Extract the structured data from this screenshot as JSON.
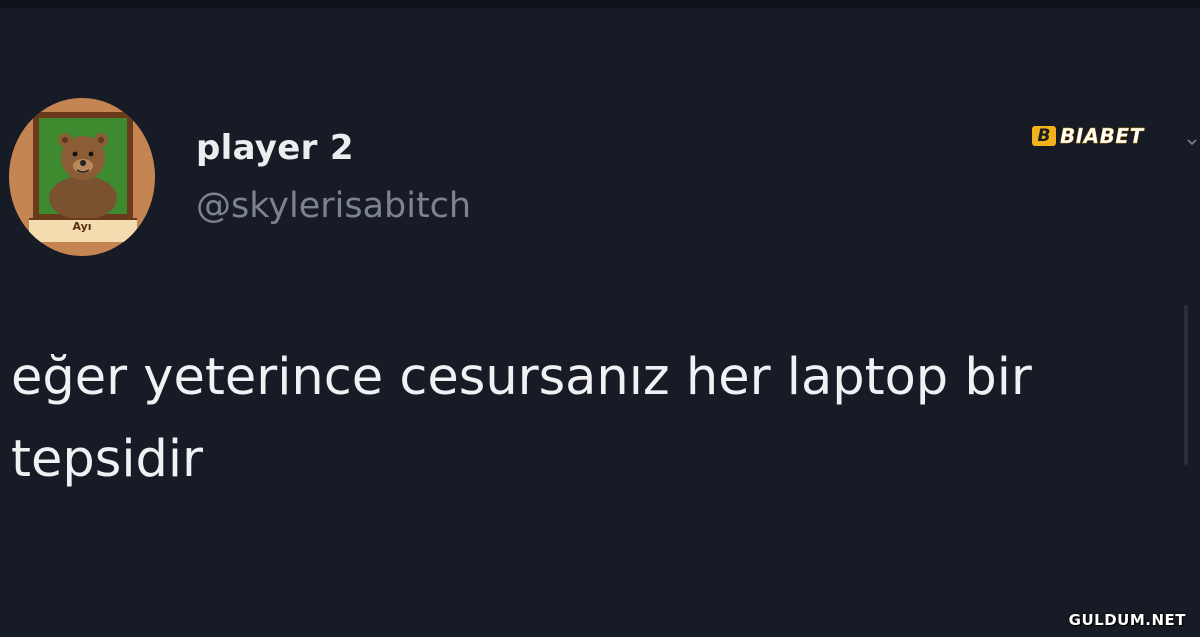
{
  "tweet": {
    "display_name": "player 2",
    "handle": "@skylerisabitch",
    "text": "eğer yeterince cesursanız her laptop bir\ntepsidir",
    "avatar": {
      "icon": "bear-portrait-icon",
      "plaque_label": "Ayı"
    },
    "menu_icon": "chevron-down-icon"
  },
  "overlay": {
    "top_watermark": "BIABET",
    "top_watermark_mark": "B",
    "bottom_watermark": "GULDUM.NET"
  },
  "colors": {
    "background": "#171b25",
    "primary_text": "#f1f1f3",
    "secondary_text": "#7d838d",
    "avatar_ring": "#c58552",
    "avatar_inner": "#3e8a2e",
    "brand_accent": "#f3b11a"
  }
}
